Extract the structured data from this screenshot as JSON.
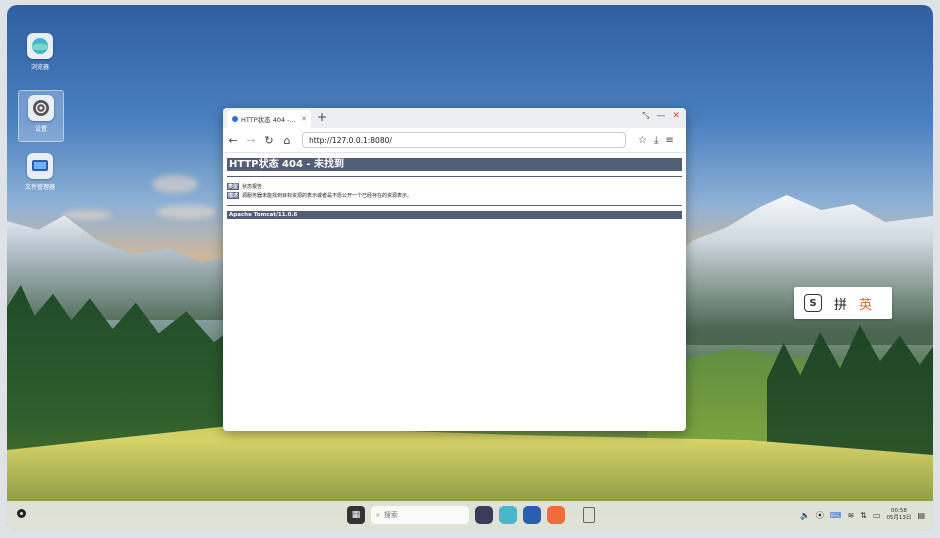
{
  "desktop": {
    "icons": [
      {
        "label": "浏览器",
        "icon": "browser-icon"
      },
      {
        "label": "设置",
        "icon": "settings-gear-icon"
      },
      {
        "label": "文件管理器",
        "icon": "file-manager-icon"
      }
    ]
  },
  "browser": {
    "tab_title": "HTTP状态 404 -...",
    "new_tab": "+",
    "url": "http://127.0.0.1:8080/",
    "page": {
      "heading": "HTTP状态 404 - 未找到",
      "type_label": "类型",
      "type_value": "状态报告",
      "desc_label": "描述",
      "desc_value": "源服务器未能找到目标资源的表示或者是不愿公开一个已经存在的资源表示。",
      "footer": "Apache Tomcat/11.0.6"
    }
  },
  "ime": {
    "logo": "S",
    "pinyin": "拼",
    "english": "英"
  },
  "taskbar": {
    "search_placeholder": "搜索",
    "time": "00:58",
    "date": "05月13日"
  }
}
